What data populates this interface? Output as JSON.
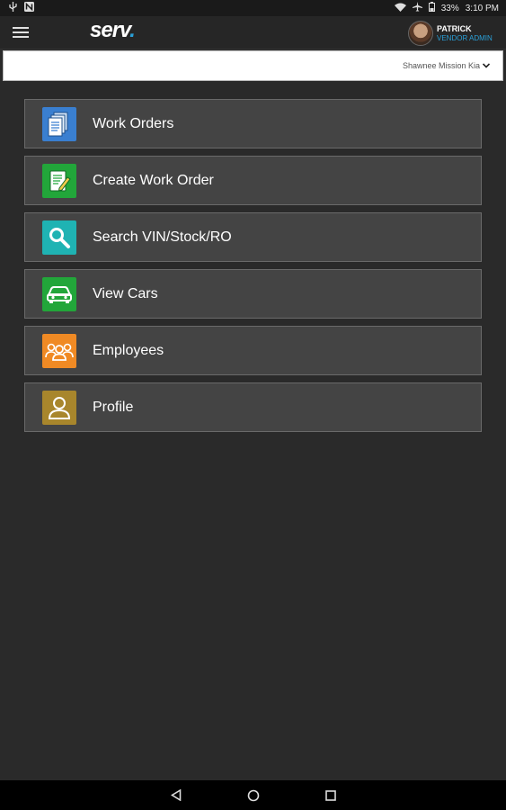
{
  "status_bar": {
    "battery": "33%",
    "time": "3:10 PM"
  },
  "app_bar": {
    "logo_text": "serv",
    "logo_dot": ".",
    "user_name": "PATRICK",
    "user_role": "VENDOR ADMIN"
  },
  "dealer": {
    "selected": "Shawnee Mission Kia"
  },
  "menu": {
    "items": [
      {
        "label": "Work Orders",
        "icon": "work-orders-icon",
        "color": "#3a7fd0"
      },
      {
        "label": "Create Work Order",
        "icon": "create-work-order-icon",
        "color": "#22a63a"
      },
      {
        "label": "Search VIN/Stock/RO",
        "icon": "search-icon",
        "color": "#1fb3b3"
      },
      {
        "label": "View Cars",
        "icon": "car-icon",
        "color": "#22a63a"
      },
      {
        "label": "Employees",
        "icon": "employees-icon",
        "color": "#f08a24"
      },
      {
        "label": "Profile",
        "icon": "profile-icon",
        "color": "#a8862c"
      }
    ]
  },
  "colors": {
    "background": "#2a2a2a",
    "item_background": "#444444",
    "accent": "#2aa0d8"
  }
}
